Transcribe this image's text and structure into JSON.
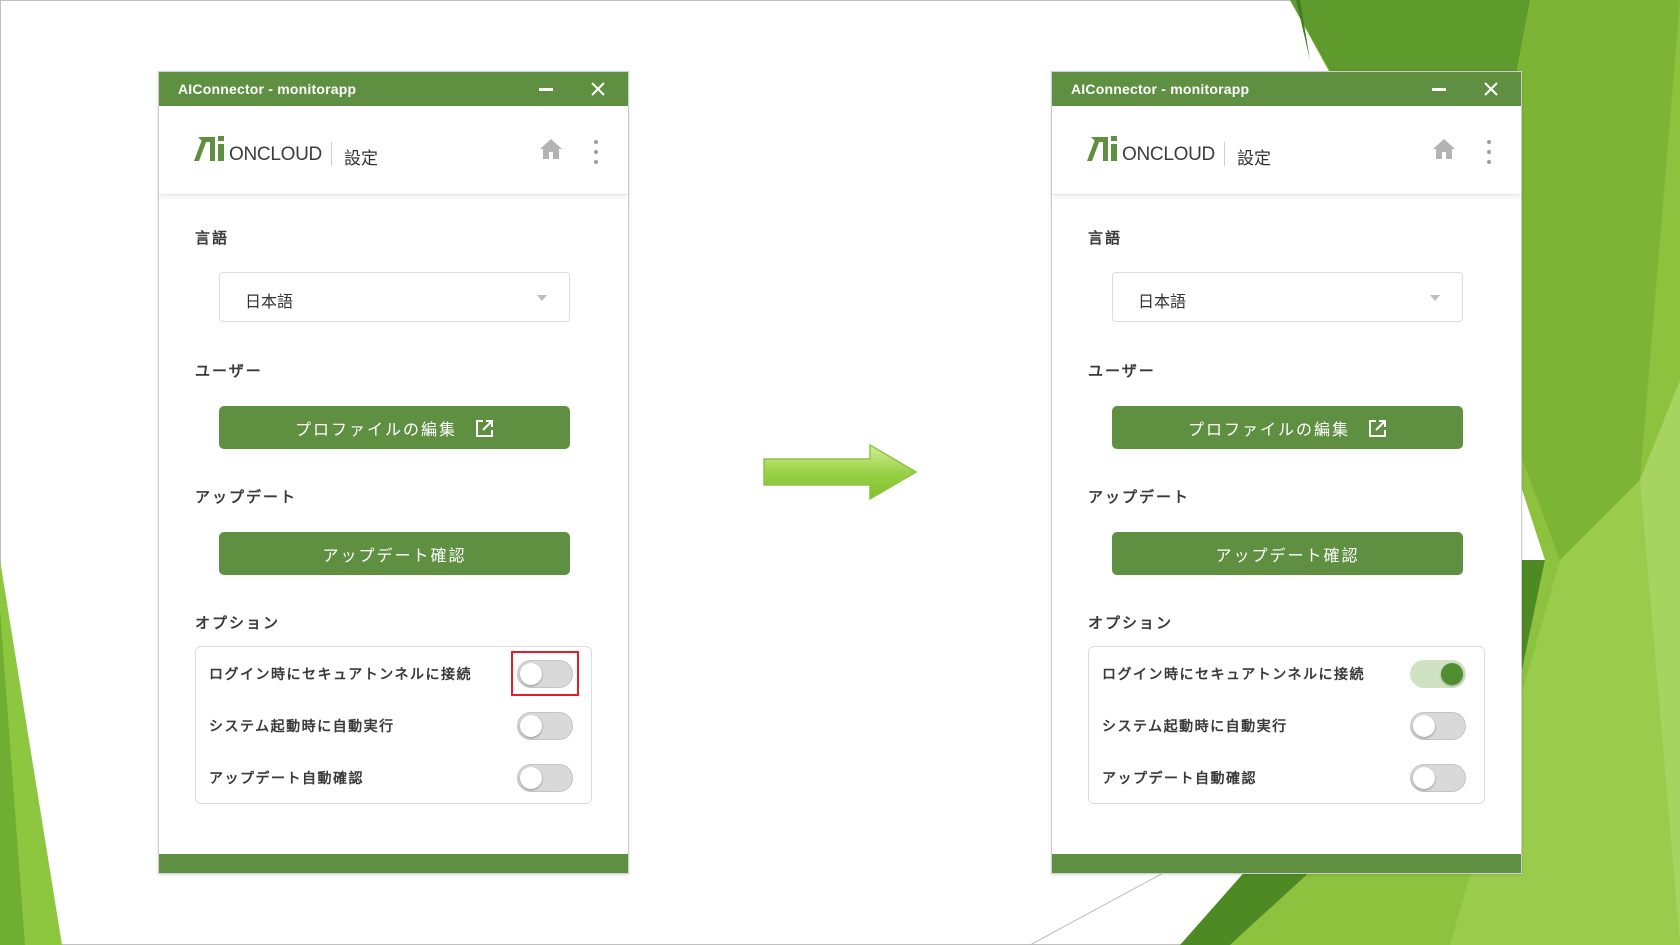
{
  "colors": {
    "accent": "#5f9042",
    "toggle_on_knob": "#4f8f2f",
    "toggle_on_track": "#cfe3c2",
    "highlight": "#e21f26",
    "background_greens": [
      "#8dc63f",
      "#5d9b2a",
      "#3f7f1f",
      "#a7d460"
    ]
  },
  "windows": [
    {
      "id": "before",
      "titlebar": {
        "title": "AIConnector - monitorapp",
        "minimize_icon": "minimize-icon",
        "close_icon": "close-icon"
      },
      "header": {
        "logo_text": "ONCLOUD",
        "page_title": "設定",
        "home_icon": "home-icon",
        "menu_icon": "more-vertical-icon"
      },
      "language": {
        "label": "言語",
        "selected": "日本語"
      },
      "user": {
        "label": "ユーザー",
        "edit_profile_button": "プロファイルの編集"
      },
      "update": {
        "label": "アップデート",
        "check_button": "アップデート確認"
      },
      "options": {
        "label": "オプション",
        "items": [
          {
            "label": "ログイン時にセキュアトンネルに接続",
            "enabled": false,
            "highlighted": true
          },
          {
            "label": "システム起動時に自動実行",
            "enabled": false
          },
          {
            "label": "アップデート自動確認",
            "enabled": false
          }
        ]
      }
    },
    {
      "id": "after",
      "titlebar": {
        "title": "AIConnector - monitorapp",
        "minimize_icon": "minimize-icon",
        "close_icon": "close-icon"
      },
      "header": {
        "logo_text": "ONCLOUD",
        "page_title": "設定",
        "home_icon": "home-icon",
        "menu_icon": "more-vertical-icon"
      },
      "language": {
        "label": "言語",
        "selected": "日本語"
      },
      "user": {
        "label": "ユーザー",
        "edit_profile_button": "プロファイルの編集"
      },
      "update": {
        "label": "アップデート",
        "check_button": "アップデート確認"
      },
      "options": {
        "label": "オプション",
        "items": [
          {
            "label": "ログイン時にセキュアトンネルに接続",
            "enabled": true
          },
          {
            "label": "システム起動時に自動実行",
            "enabled": false
          },
          {
            "label": "アップデート自動確認",
            "enabled": false
          }
        ]
      }
    }
  ],
  "transition": {
    "icon": "arrow-right-icon"
  }
}
